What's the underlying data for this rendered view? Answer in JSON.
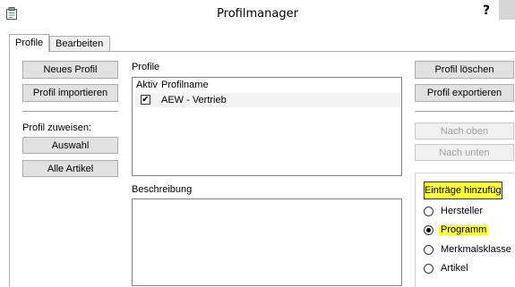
{
  "window": {
    "title": "Profilmanager",
    "help_label": "?"
  },
  "tabs": [
    {
      "label": "Profile"
    },
    {
      "label": "Bearbeiten"
    }
  ],
  "left": {
    "new_profile": "Neues Profil",
    "import_profile": "Profil importieren",
    "assign_label": "Profil zuweisen:",
    "selection": "Auswahl",
    "all_articles": "Alle Artikel"
  },
  "profiles": {
    "label": "Profile",
    "columns": [
      "Aktiv",
      "Profilname"
    ],
    "rows": [
      {
        "active": true,
        "name": "AEW - Vertrieb"
      }
    ]
  },
  "description": {
    "label": "Beschreibung"
  },
  "right": {
    "delete_profile": "Profil löschen",
    "export_profile": "Profil exportieren",
    "move_up": "Nach oben",
    "move_down": "Nach unten",
    "add_entries": "Einträge hinzufügen",
    "options": [
      {
        "label": "Hersteller",
        "selected": false
      },
      {
        "label": "Programm",
        "selected": true
      },
      {
        "label": "Merkmalsklasse",
        "selected": false
      },
      {
        "label": "Artikel",
        "selected": false
      }
    ]
  },
  "colors": {
    "highlight": "#ffff3c"
  }
}
